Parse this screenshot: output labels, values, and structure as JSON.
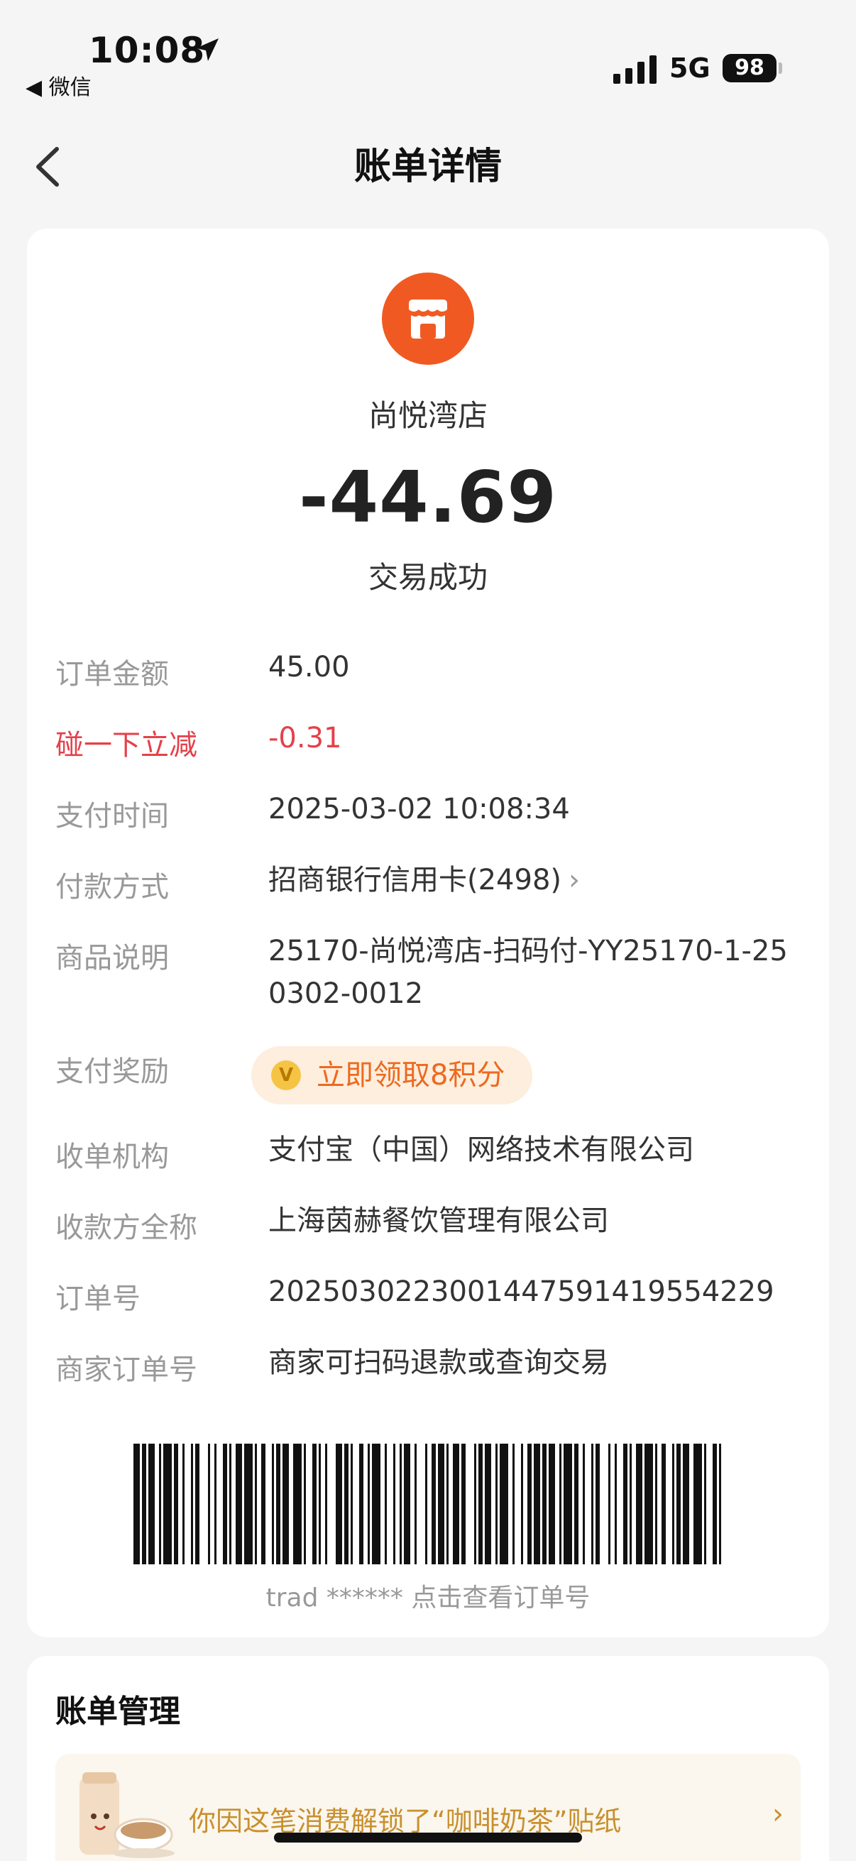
{
  "status_bar": {
    "time": "10:08",
    "back_app": "◀ 微信",
    "network": "5G",
    "battery": "98"
  },
  "nav": {
    "title": "账单详情"
  },
  "merchant": {
    "name": "尚悦湾店",
    "amount": "-44.69",
    "status": "交易成功",
    "icon_color": "#f05a22"
  },
  "details": {
    "order_amount_label": "订单金额",
    "order_amount": "45.00",
    "discount_label": "碰一下立减",
    "discount": "-0.31",
    "pay_time_label": "支付时间",
    "pay_time": "2025-03-02 10:08:34",
    "pay_method_label": "付款方式",
    "pay_method": "招商银行信用卡(2498)",
    "goods_label": "商品说明",
    "goods": "25170-尚悦湾店-扫码付-YY25170-1-250302-0012",
    "reward_label": "支付奖励",
    "reward_coin": "V",
    "reward": "立即领取8积分",
    "acquirer_label": "收单机构",
    "acquirer": "支付宝（中国）网络技术有限公司",
    "payee_label": "收款方全称",
    "payee": "上海茵赫餐饮管理有限公司",
    "order_no_label": "订单号",
    "order_no": "2025030223001447591419554229",
    "merchant_order_label": "商家订单号",
    "merchant_order": "商家可扫码退款或查询交易"
  },
  "barcode": {
    "caption": "trad ****** 点击查看订单号"
  },
  "bill_management": {
    "title": "账单管理",
    "promo_text": "你因这笔消费解锁了“咖啡奶茶”贴纸"
  },
  "colors": {
    "accent_red": "#e5404a",
    "reward_orange": "#ec6a20",
    "promo_gold": "#c8902e"
  }
}
